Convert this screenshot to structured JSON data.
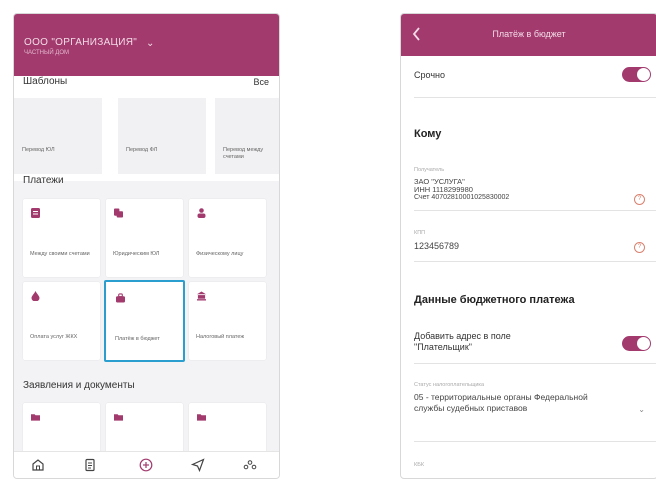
{
  "colors": {
    "brand": "#a23a6e",
    "accent_selected": "#2a9fcf",
    "icon": "#a23a6e",
    "info_icon": "#d9826f"
  },
  "left": {
    "org": {
      "name": "ООО \"ОРГАНИЗАЦИЯ\"",
      "sub": "ЧАСТНЫЙ ДОМ"
    },
    "templates": {
      "title": "Шаблоны",
      "all": "Все",
      "items": [
        {
          "label": "Перевод ЮЛ"
        },
        {
          "label": "Перевод ФЛ"
        },
        {
          "label": "Перевод между счетами"
        }
      ]
    },
    "payments": {
      "title": "Платежи",
      "items": [
        {
          "label": "Между своими счетами",
          "icon": "document-icon"
        },
        {
          "label": "Юридическим ЮЛ",
          "icon": "documents-icon"
        },
        {
          "label": "Физическому лицу",
          "icon": "person-icon"
        },
        {
          "label": "Оплата услуг ЖКХ",
          "icon": "drop-icon"
        },
        {
          "label": "Платёж в бюджет",
          "icon": "bag-icon"
        },
        {
          "label": "Налоговый платеж",
          "icon": "bank-icon"
        }
      ]
    },
    "applications": {
      "title": "Заявления и документы"
    },
    "tabbar": [
      {
        "icon": "home-icon"
      },
      {
        "icon": "document-list-icon"
      },
      {
        "icon": "plus-circle-icon"
      },
      {
        "icon": "send-icon"
      },
      {
        "icon": "more-icon"
      }
    ]
  },
  "right": {
    "title": "Платёж в бюджет",
    "urgent": {
      "label": "Срочно",
      "on": true
    },
    "to_heading": "Кому",
    "recipient": {
      "label": "Получатель",
      "lines": [
        "ЗАО \"УСЛУГА\"",
        "ИНН 1118299980",
        "Счет 40702810001025830002"
      ]
    },
    "kpp": {
      "label": "КПП",
      "value": "123456789"
    },
    "budget_heading": "Данные бюджетного платежа",
    "add_address": {
      "label": "Добавить адрес в поле \"Плательщик\"",
      "on": true
    },
    "payer_status": {
      "label": "Статус налогоплательщика",
      "value": "05 - территориальные органы Федеральной службы судебных приставов"
    },
    "kbk_label": "КБК"
  }
}
